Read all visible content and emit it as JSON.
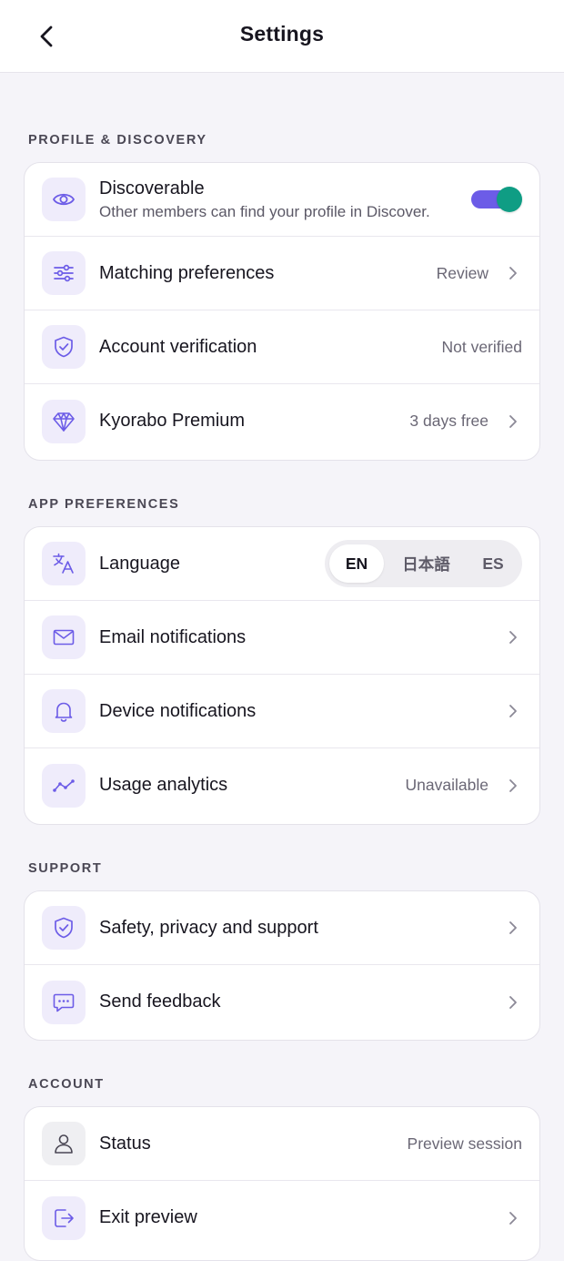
{
  "header": {
    "title": "Settings",
    "back_icon": "chevron-left-icon"
  },
  "sections": {
    "profile": {
      "label": "PROFILE & DISCOVERY",
      "discoverable": {
        "title": "Discoverable",
        "subtitle": "Other members can find your profile in Discover.",
        "icon": "eye-icon",
        "toggle_on": true
      },
      "matching": {
        "title": "Matching preferences",
        "value": "Review",
        "icon": "sliders-icon"
      },
      "verification": {
        "title": "Account verification",
        "value": "Not verified",
        "icon": "shield-check-icon"
      },
      "premium": {
        "title": "Kyorabo Premium",
        "value": "3 days free",
        "icon": "diamond-icon"
      }
    },
    "app": {
      "label": "APP PREFERENCES",
      "language": {
        "title": "Language",
        "icon": "translate-icon",
        "options": [
          "EN",
          "日本語",
          "ES"
        ],
        "selected": "EN"
      },
      "email": {
        "title": "Email notifications",
        "icon": "mail-icon"
      },
      "device": {
        "title": "Device notifications",
        "icon": "bell-icon"
      },
      "analytics": {
        "title": "Usage analytics",
        "value": "Unavailable",
        "icon": "trend-icon"
      }
    },
    "support": {
      "label": "SUPPORT",
      "safety": {
        "title": "Safety, privacy and support",
        "icon": "shield-check-icon"
      },
      "feedback": {
        "title": "Send feedback",
        "icon": "chat-icon"
      }
    },
    "account": {
      "label": "ACCOUNT",
      "status": {
        "title": "Status",
        "value": "Preview session",
        "icon": "user-icon"
      },
      "exit": {
        "title": "Exit preview",
        "icon": "exit-icon"
      }
    }
  },
  "colors": {
    "accent": "#6c5ce7",
    "toggle_knob": "#0f9d84",
    "icon_bg": "#efecfb",
    "page_bg": "#f5f4f9"
  }
}
